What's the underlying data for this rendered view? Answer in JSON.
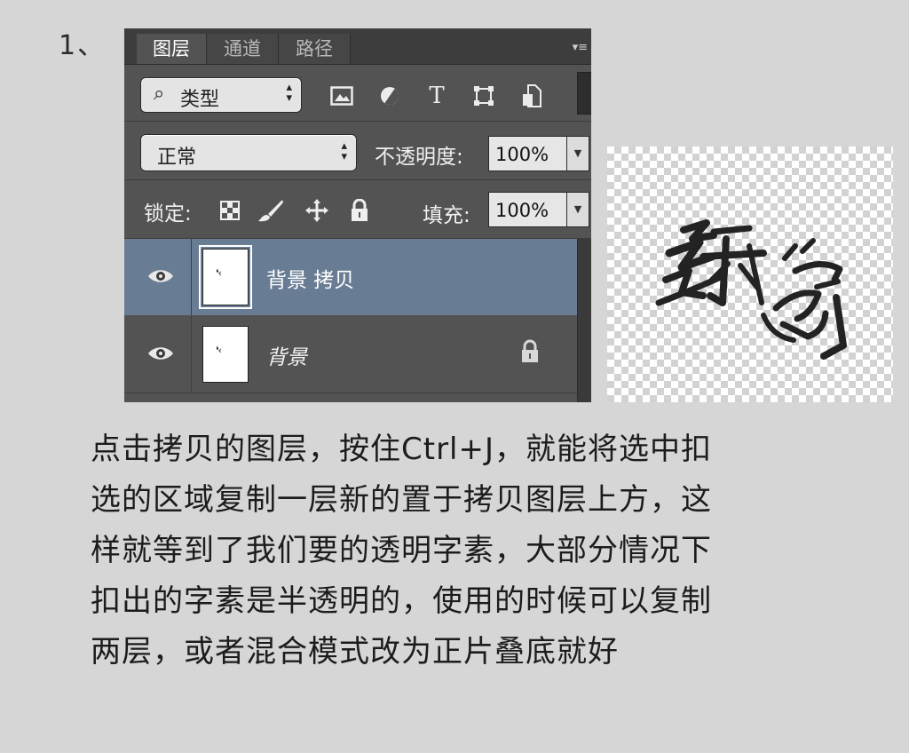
{
  "step_number": "1、",
  "panel": {
    "tabs": [
      {
        "label": "图层",
        "active": true
      },
      {
        "label": "通道",
        "active": false
      },
      {
        "label": "路径",
        "active": false
      }
    ],
    "filter": {
      "label": "类型",
      "icons": [
        "image-filter-icon",
        "adjustment-filter-icon",
        "type-filter-icon",
        "shape-filter-icon",
        "smart-object-filter-icon"
      ],
      "type_icon_glyph": "T"
    },
    "blend_mode": "正常",
    "opacity_label": "不透明度:",
    "opacity_value": "100%",
    "lock_label": "锁定:",
    "lock_icons": [
      "lock-transparent-pixels-icon",
      "lock-image-pixels-icon",
      "lock-position-icon",
      "lock-all-icon"
    ],
    "fill_label": "填充:",
    "fill_value": "100%",
    "layers": [
      {
        "name": "背景 拷贝",
        "selected": true,
        "visible": true,
        "locked": false
      },
      {
        "name": "背景",
        "selected": false,
        "visible": true,
        "locked": true
      }
    ],
    "thumb_glyph": "❛‹"
  },
  "description_lines": [
    "点击拷贝的图层，按住Ctrl+J，就能将选中扣",
    "选的区域复制一层新的置于拷贝图层上方，这",
    "样就等到了我们要的透明字素，大部分情况下",
    "扣出的字素是半透明的，使用的时候可以复制",
    "两层，或者混合模式改为正片叠底就好"
  ],
  "colors": {
    "page_background": "#d6d6d6",
    "panel_background": "#535353",
    "selected_layer": "#687d94",
    "text": "#1c1c1c"
  }
}
